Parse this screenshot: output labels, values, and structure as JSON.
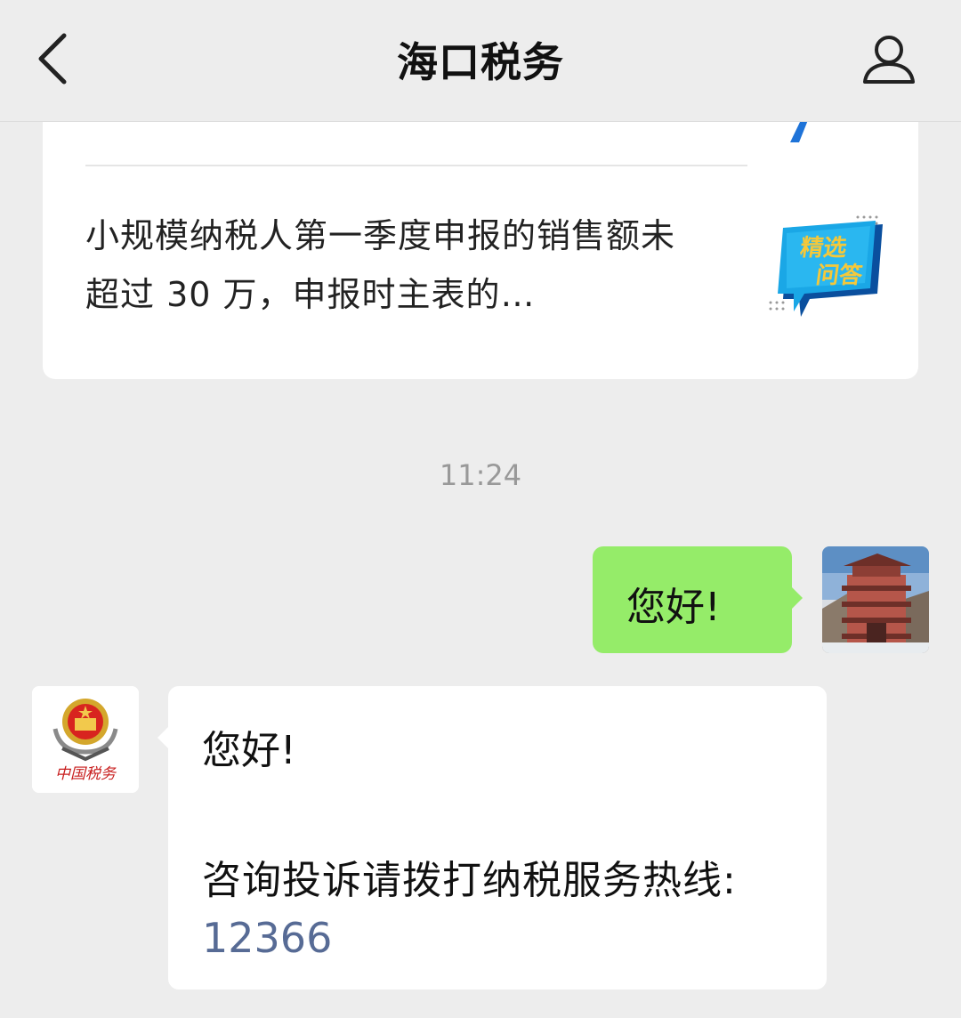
{
  "header": {
    "title": "海口税务",
    "back_icon": "chevron-left-icon",
    "profile_icon": "person-icon"
  },
  "article_card": {
    "text": "小规模纳税人第一季度申报的销售额未超过 30 万，申报时主表的…",
    "thumbnail_text_line1": "精选",
    "thumbnail_text_line2": "问答",
    "thumbnail_colors": {
      "main": "#1aa7e6",
      "dark": "#0a4f9e",
      "accent": "#f5c83a"
    }
  },
  "timestamp": "11:24",
  "messages": [
    {
      "from": "me",
      "text": "您好!",
      "bubble_color": "#95ec69"
    },
    {
      "from": "bot",
      "greeting": "您好!",
      "body": "咨询投诉请拨打纳税服务热线:",
      "phone": "12366",
      "link_color": "#576b95"
    }
  ],
  "bot_logo_text": "中国税务"
}
